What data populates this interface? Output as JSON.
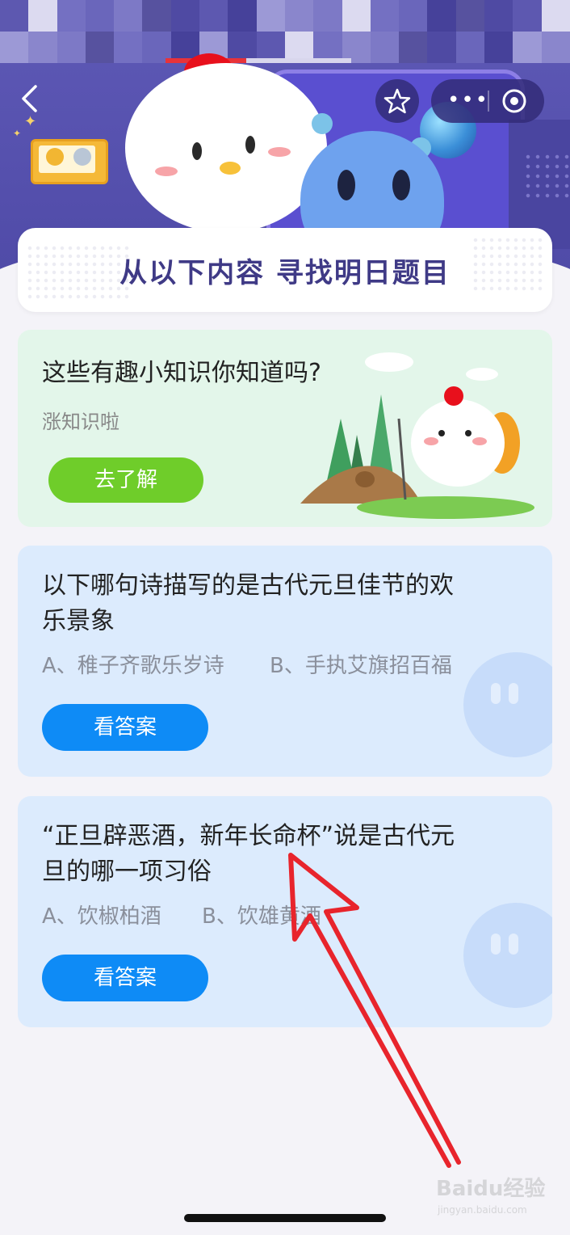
{
  "colors": {
    "header_bg": "#5b56b3",
    "green_button": "#6fcd2a",
    "blue_button": "#0e8bf6",
    "annotation_arrow": "#e8242c"
  },
  "nav": {
    "back_icon": "chevron-left-icon",
    "favorite_icon": "star-icon",
    "more_icon": "more-dots-icon",
    "more_label": "•••",
    "close_icon": "target-circle-icon"
  },
  "banner": {
    "title": "从以下内容 寻找明日题目"
  },
  "promo_card": {
    "title": "这些有趣小知识你知道吗?",
    "subtitle": "涨知识啦",
    "button_label": "去了解"
  },
  "questions": [
    {
      "title_line1": "以下哪句诗描写的是古代元旦佳节的欢",
      "title_line2": "乐景象",
      "option_a": "A、稚子齐歌乐岁诗",
      "option_b": "B、手执艾旗招百福",
      "button_label": "看答案"
    },
    {
      "title_line1": "“正旦辟恶酒，新年长命杯”说是古代元",
      "title_line2": "旦的哪一项习俗",
      "option_a": "A、饮椒柏酒",
      "option_b": "B、饮雄黄酒",
      "button_label": "看答案"
    }
  ],
  "watermark": {
    "text": "Baidu经验",
    "sub": "jingyan.baidu.com"
  }
}
